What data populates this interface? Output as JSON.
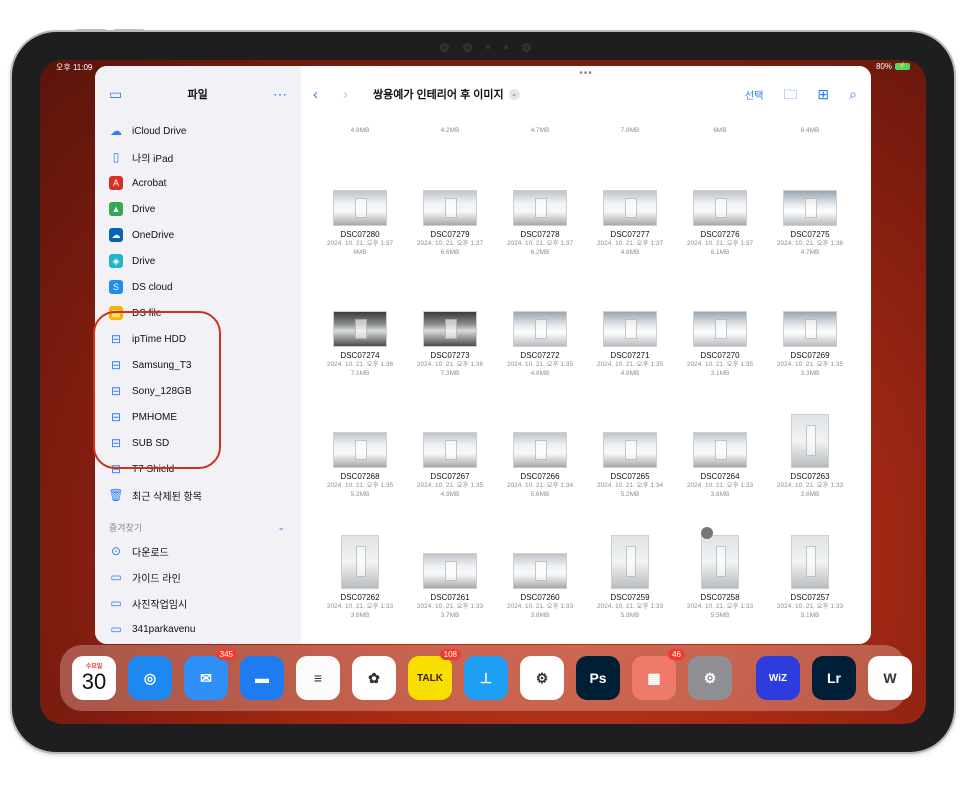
{
  "status": {
    "time": "오후 11:09",
    "battery_pct": "80%",
    "battery_label": ""
  },
  "sidebar": {
    "title": "파일",
    "locations": [
      {
        "label": "iCloud Drive",
        "icon": "cloud-icon"
      },
      {
        "label": "나의 iPad",
        "icon": "ipad-icon"
      },
      {
        "label": "Acrobat",
        "icon": "acrobat-icon"
      },
      {
        "label": "Drive",
        "icon": "google-drive-icon"
      },
      {
        "label": "OneDrive",
        "icon": "onedrive-icon"
      },
      {
        "label": "Drive",
        "icon": "drive-app-icon"
      },
      {
        "label": "DS cloud",
        "icon": "ds-cloud-icon"
      },
      {
        "label": "DS file",
        "icon": "ds-file-icon"
      },
      {
        "label": "ipTime HDD",
        "icon": "external-drive-icon"
      },
      {
        "label": "Samsung_T3",
        "icon": "external-drive-icon"
      },
      {
        "label": "Sony_128GB",
        "icon": "external-drive-icon"
      },
      {
        "label": "PMHOME",
        "icon": "external-drive-icon"
      },
      {
        "label": "SUB SD",
        "icon": "external-drive-icon"
      },
      {
        "label": "T7 Shield",
        "icon": "external-drive-icon"
      },
      {
        "label": "최근 삭제된 항목",
        "icon": "trash-icon"
      }
    ],
    "favorites_header": "즐겨찾기",
    "favorites": [
      {
        "label": "다운로드",
        "icon": "download-icon"
      },
      {
        "label": "가이드 라인",
        "icon": "folder-icon"
      },
      {
        "label": "사진작업임시",
        "icon": "folder-icon"
      },
      {
        "label": "341parkavenu",
        "icon": "folder-icon"
      }
    ]
  },
  "toolbar": {
    "folder_title": "쌍용예가 인테리어 후 이미지",
    "select_label": "선택"
  },
  "prev_sizes": [
    "4.8MB",
    "4.2MB",
    "4.7MB",
    "7.8MB",
    "6MB",
    "6.4MB"
  ],
  "files": [
    {
      "name": "DSC07280",
      "date": "2024. 10. 21. 오후 1:37",
      "size": "6MB",
      "orient": "land",
      "tone": ""
    },
    {
      "name": "DSC07279",
      "date": "2024. 10. 21. 오후 1:37",
      "size": "6.6MB",
      "orient": "land",
      "tone": ""
    },
    {
      "name": "DSC07278",
      "date": "2024. 10. 21. 오후 1:37",
      "size": "6.2MB",
      "orient": "land",
      "tone": ""
    },
    {
      "name": "DSC07277",
      "date": "2024. 10. 21. 오후 1:37",
      "size": "4.8MB",
      "orient": "land",
      "tone": ""
    },
    {
      "name": "DSC07276",
      "date": "2024. 10. 21. 오후 1:37",
      "size": "6.1MB",
      "orient": "land",
      "tone": ""
    },
    {
      "name": "DSC07275",
      "date": "2024. 10. 21. 오후 1:36",
      "size": "4.7MB",
      "orient": "land",
      "tone": "blue"
    },
    {
      "name": "DSC07274",
      "date": "2024. 10. 21. 오후 1:36",
      "size": "7.1MB",
      "orient": "land",
      "tone": "dark"
    },
    {
      "name": "DSC07273",
      "date": "2024. 10. 21. 오후 1:36",
      "size": "7.3MB",
      "orient": "land",
      "tone": "dark"
    },
    {
      "name": "DSC07272",
      "date": "2024. 10. 21. 오후 1:35",
      "size": "4.8MB",
      "orient": "land",
      "tone": "blue"
    },
    {
      "name": "DSC07271",
      "date": "2024. 10. 21. 오후 1:35",
      "size": "4.8MB",
      "orient": "land",
      "tone": "blue"
    },
    {
      "name": "DSC07270",
      "date": "2024. 10. 21. 오후 1:35",
      "size": "3.1MB",
      "orient": "land",
      "tone": "blue"
    },
    {
      "name": "DSC07269",
      "date": "2024. 10. 21. 오후 1:35",
      "size": "3.3MB",
      "orient": "land",
      "tone": "blue"
    },
    {
      "name": "DSC07268",
      "date": "2024. 10. 21. 오후 1:35",
      "size": "5.2MB",
      "orient": "land",
      "tone": ""
    },
    {
      "name": "DSC07267",
      "date": "2024. 10. 21. 오후 1:35",
      "size": "4.9MB",
      "orient": "land",
      "tone": ""
    },
    {
      "name": "DSC07266",
      "date": "2024. 10. 21. 오후 1:34",
      "size": "5.6MB",
      "orient": "land",
      "tone": ""
    },
    {
      "name": "DSC07265",
      "date": "2024. 10. 21. 오후 1:34",
      "size": "5.2MB",
      "orient": "land",
      "tone": ""
    },
    {
      "name": "DSC07264",
      "date": "2024. 10. 21. 오후 1:33",
      "size": "3.8MB",
      "orient": "land",
      "tone": ""
    },
    {
      "name": "DSC07263",
      "date": "2024. 10. 21. 오후 1:33",
      "size": "3.6MB",
      "orient": "port",
      "tone": ""
    },
    {
      "name": "DSC07262",
      "date": "2024. 10. 21. 오후 1:33",
      "size": "3.6MB",
      "orient": "port",
      "tone": ""
    },
    {
      "name": "DSC07261",
      "date": "2024. 10. 21. 오후 1:33",
      "size": "3.7MB",
      "orient": "land",
      "tone": ""
    },
    {
      "name": "DSC07260",
      "date": "2024. 10. 21. 오후 1:33",
      "size": "3.8MB",
      "orient": "land",
      "tone": ""
    },
    {
      "name": "DSC07259",
      "date": "2024. 10. 21. 오후 1:33",
      "size": "5.8MB",
      "orient": "port",
      "tone": ""
    },
    {
      "name": "DSC07258",
      "date": "2024. 10. 21. 오후 1:33",
      "size": "5.5MB",
      "orient": "port",
      "tone": ""
    },
    {
      "name": "DSC07257",
      "date": "2024. 10. 21. 오후 1:33",
      "size": "5.1MB",
      "orient": "port",
      "tone": ""
    }
  ],
  "dock": [
    {
      "name": "calendar",
      "day": "수요일",
      "date": "30",
      "color": "#ffffff",
      "badge": ""
    },
    {
      "name": "safari",
      "glyph": "◎",
      "color": "#1e88f0",
      "badge": ""
    },
    {
      "name": "mail",
      "glyph": "✉",
      "color": "#2f8ff7",
      "badge": "345"
    },
    {
      "name": "files",
      "glyph": "▬",
      "color": "#1e7cf0",
      "badge": ""
    },
    {
      "name": "notes",
      "glyph": "≡",
      "color": "#fbfbfb",
      "badge": ""
    },
    {
      "name": "photos",
      "glyph": "✿",
      "color": "#ffffff",
      "badge": ""
    },
    {
      "name": "kakaotalk",
      "glyph": "TALK",
      "color": "#f9df00",
      "badge": "108"
    },
    {
      "name": "keynote",
      "glyph": "⊥",
      "color": "#1f9ef6",
      "badge": ""
    },
    {
      "name": "chatgpt",
      "glyph": "⚙",
      "color": "#ffffff",
      "badge": ""
    },
    {
      "name": "photoshop",
      "glyph": "Ps",
      "color": "#001e36",
      "badge": ""
    },
    {
      "name": "app-folder",
      "glyph": "▦",
      "color": "#f07a6a",
      "badge": "46"
    },
    {
      "name": "settings",
      "glyph": "⚙",
      "color": "#8e8e93",
      "badge": ""
    },
    {
      "name": "wiz",
      "glyph": "WiZ",
      "color": "#2d3cdc",
      "badge": ""
    },
    {
      "name": "lightroom",
      "glyph": "Lr",
      "color": "#001e36",
      "badge": ""
    },
    {
      "name": "word",
      "glyph": "W",
      "color": "#ffffff",
      "badge": ""
    }
  ]
}
